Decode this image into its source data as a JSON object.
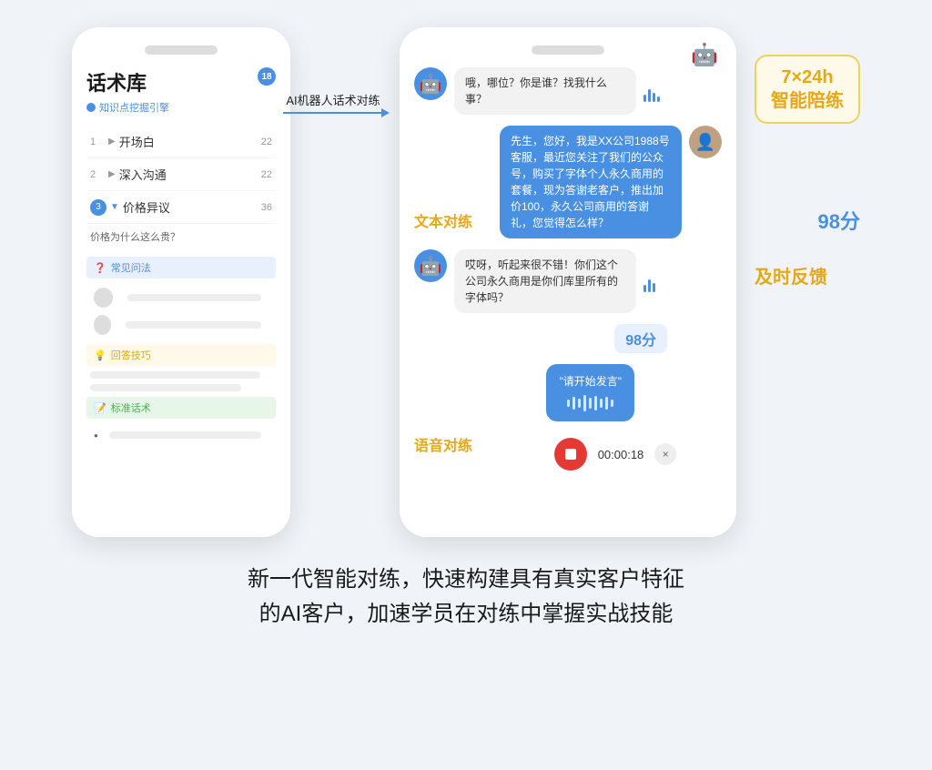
{
  "page": {
    "bg_color": "#f0f4f8"
  },
  "left_phone": {
    "title": "话术库",
    "subtitle": "知识点挖掘引擎",
    "badge": "18",
    "menu_items": [
      {
        "num": "1",
        "label": "开场白",
        "count": "22",
        "active": false
      },
      {
        "num": "2",
        "label": "深入沟通",
        "count": "22",
        "active": false
      },
      {
        "num": "3",
        "label": "价格异议",
        "count": "36",
        "active": true
      }
    ],
    "sub_question": "价格为什么这么贵？",
    "sections": [
      {
        "type": "blue",
        "icon": "❓",
        "label": "常见问法"
      },
      {
        "type": "yellow",
        "icon": "💡",
        "label": "回答技巧"
      },
      {
        "type": "green",
        "icon": "📝",
        "label": "标准话术"
      }
    ]
  },
  "arrow": {
    "label": "AI机器人话术对练"
  },
  "right_phone": {
    "messages": [
      {
        "type": "bot",
        "text": "哦，哪位？你是谁？找我什么事？",
        "has_sound": true
      },
      {
        "type": "human",
        "text": "先生，您好，我是XX公司1988号客服，最近您关注了我们的公众号，购买了字体个人永久商用的套餐，现为答谢老客户，推出加价100，永久公司商用的答谢礼，您觉得怎么样？"
      },
      {
        "type": "bot",
        "text": "哎呀，听起来很不错！你们这个公司永久商用是你们库里所有的字体吗？",
        "has_sound": true
      }
    ],
    "score": "98分",
    "voice_bubble": {
      "label": "\"请开始发言\"",
      "waveform": [
        8,
        14,
        10,
        18,
        12,
        16,
        10,
        14,
        8
      ]
    },
    "recording": {
      "timer": "00:00:18"
    },
    "text_practice_label": "文本对练",
    "voice_practice_label": "语音对练"
  },
  "float_labels": {
    "hours": "7×24h",
    "hours_sub": "智能陪练",
    "score_label": "98分",
    "feedback_label": "及时反馈"
  },
  "bottom_text": {
    "line1": "新一代智能对练，快速构建具有真实客户特征",
    "line2": "的AI客户，加速学员在对练中掌握实战技能"
  }
}
